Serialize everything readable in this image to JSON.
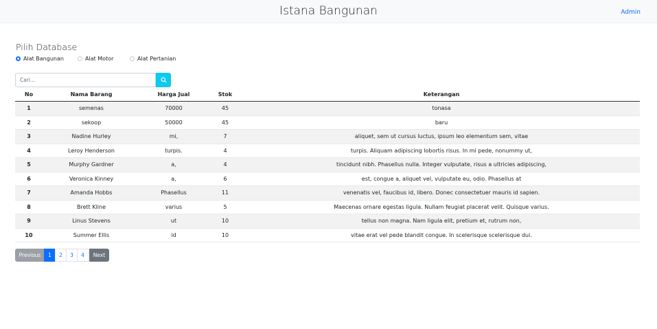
{
  "app": {
    "title": "Istana Bangunan",
    "admin_label": "Admin"
  },
  "section": {
    "title": "Pilih Database"
  },
  "radios": [
    {
      "label": "Alat Bangunan",
      "checked": true
    },
    {
      "label": "Alat Motor",
      "checked": false
    },
    {
      "label": "Alat Pertanian",
      "checked": false
    }
  ],
  "search": {
    "placeholder": "Cari...",
    "value": "",
    "icon": "search-icon"
  },
  "table": {
    "headers": [
      "No",
      "Nama Barang",
      "Harga Jual",
      "Stok",
      "Keterangan"
    ],
    "rows": [
      [
        "1",
        "semenas",
        "70000",
        "45",
        "tonasa"
      ],
      [
        "2",
        "sekoop",
        "50000",
        "45",
        "baru"
      ],
      [
        "3",
        "Nadine Hurley",
        "mi,",
        "7",
        "aliquet, sem ut cursus luctus, ipsum leo elementum sem, vitae"
      ],
      [
        "4",
        "Leroy Henderson",
        "turpis.",
        "4",
        "turpis. Aliquam adipiscing lobortis risus. In mi pede, nonummy ut,"
      ],
      [
        "5",
        "Murphy Gardner",
        "a,",
        "4",
        "tincidunt nibh. Phasellus nulla. Integer vulputate, risus a ultricies adipiscing,"
      ],
      [
        "6",
        "Veronica Kinney",
        "a,",
        "6",
        "est, congue a, aliquet vel, vulputate eu, odio. Phasellus at"
      ],
      [
        "7",
        "Amanda Hobbs",
        "Phasellus",
        "11",
        "venenatis vel, faucibus id, libero. Donec consectetuer mauris id sapien."
      ],
      [
        "8",
        "Brett Kline",
        "varius",
        "5",
        "Maecenas ornare egestas ligula. Nullam feugiat placerat velit. Quisque varius."
      ],
      [
        "9",
        "Linus Stevens",
        "ut",
        "10",
        "tellus non magna. Nam ligula elit, pretium et, rutrum non,"
      ],
      [
        "10",
        "Summer Ellis",
        "id",
        "10",
        "vitae erat vel pede blandit congue. In scelerisque scelerisque dui."
      ]
    ]
  },
  "pagination": {
    "previous": "Previous",
    "pages": [
      "1",
      "2",
      "3",
      "4"
    ],
    "active": "1",
    "next": "Next"
  }
}
